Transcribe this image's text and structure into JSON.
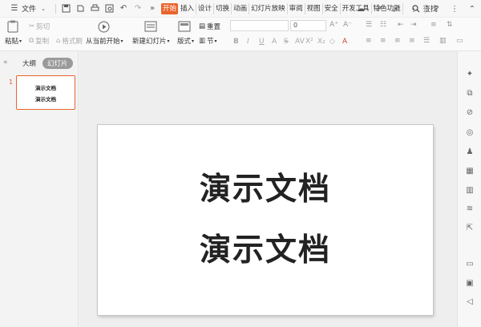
{
  "menu": {
    "file_label": "文件",
    "tabs": [
      "开始",
      "插入",
      "设计",
      "切换",
      "动画",
      "幻灯片放映",
      "审阅",
      "视图",
      "安全",
      "开发工具",
      "特色功能"
    ],
    "active_tab": "开始",
    "search_label": "查找"
  },
  "ribbon": {
    "paste_label": "粘贴",
    "cut_label": "剪切",
    "copy_label": "复制",
    "format_painter_label": "格式刷",
    "from_current_label": "从当前开始",
    "new_slide_label": "新建幻灯片",
    "layout_label": "版式",
    "reset_label": "重置",
    "section_label": "节",
    "font_size_value": "0"
  },
  "left_panel": {
    "outline_tab": "大纲",
    "slides_tab": "幻灯片",
    "slides": [
      {
        "number": "1",
        "lines": [
          "演示文档",
          "演示文档"
        ]
      }
    ]
  },
  "slide": {
    "lines": [
      "演示文档",
      "演示文档"
    ]
  },
  "icons": {
    "accent_color": "#e8642c",
    "right_sidebar": [
      "magic-icon",
      "copy-icon",
      "link-icon",
      "location-icon",
      "stamp-icon",
      "grid-icon",
      "chart-icon",
      "settings-icon",
      "share-icon",
      "archive-icon",
      "image-icon",
      "speaker-icon"
    ]
  }
}
